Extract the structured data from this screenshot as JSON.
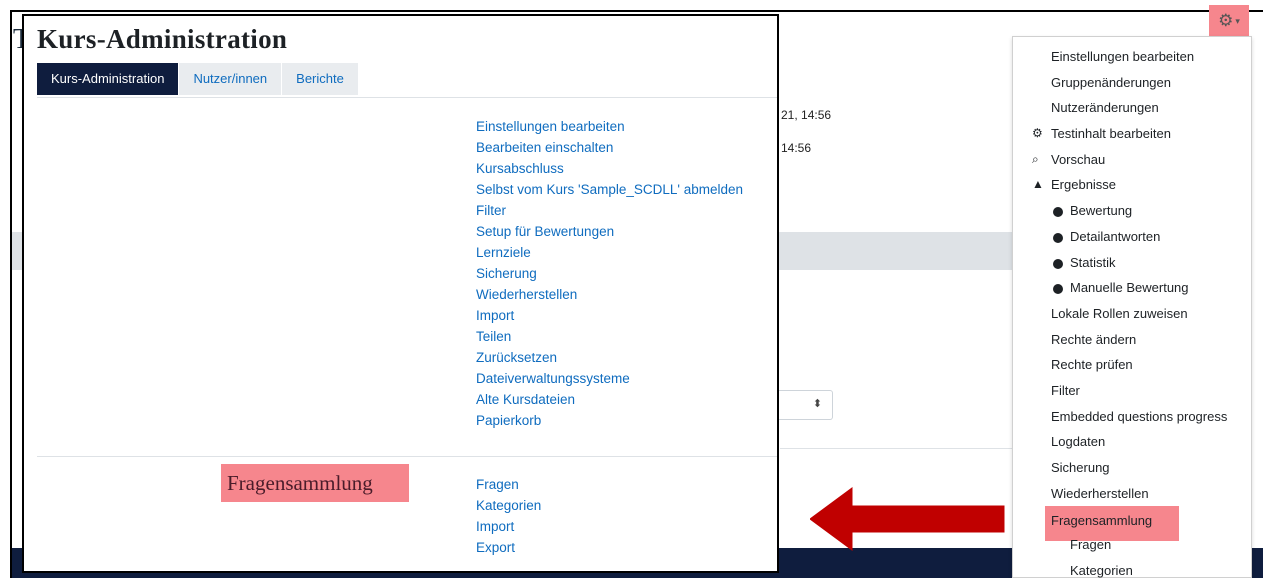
{
  "background": {
    "title_fragment": "T",
    "text_line_1": "21, 14:56",
    "text_line_2": "14:56",
    "select_caret": "⬍"
  },
  "admin": {
    "title": "Kurs-Administration",
    "tabs": [
      {
        "label": "Kurs-Administration",
        "active": true
      },
      {
        "label": "Nutzer/innen",
        "active": false
      },
      {
        "label": "Berichte",
        "active": false
      }
    ],
    "links": [
      "Einstellungen bearbeiten",
      "Bearbeiten einschalten",
      "Kursabschluss",
      "Selbst vom Kurs 'Sample_SCDLL' abmelden",
      "Filter",
      "Setup für Bewertungen",
      "Lernziele",
      "Sicherung",
      "Wiederherstellen",
      "Import",
      "Teilen",
      "Zurücksetzen",
      "Dateiverwaltungssysteme",
      "Alte Kursdateien",
      "Papierkorb"
    ],
    "question_bank": {
      "label": "Fragensammlung",
      "links": [
        "Fragen",
        "Kategorien",
        "Import",
        "Export"
      ]
    }
  },
  "action_menu": {
    "gear_icon": "⚙",
    "caret": "▾",
    "items": [
      {
        "label": "Einstellungen bearbeiten"
      },
      {
        "label": "Gruppenänderungen"
      },
      {
        "label": "Nutzeränderungen"
      },
      {
        "label": "Testinhalt bearbeiten",
        "icon": "⚙"
      },
      {
        "label": "Vorschau",
        "icon": "⌕"
      },
      {
        "label": "Ergebnisse",
        "icon": "▲"
      },
      {
        "label": "Bewertung"
      },
      {
        "label": "Detailantworten"
      },
      {
        "label": "Statistik"
      },
      {
        "label": "Manuelle Bewertung"
      },
      {
        "label": "Lokale Rollen zuweisen"
      },
      {
        "label": "Rechte ändern"
      },
      {
        "label": "Rechte prüfen"
      },
      {
        "label": "Filter"
      },
      {
        "label": "Embedded questions progress"
      },
      {
        "label": "Logdaten"
      },
      {
        "label": "Sicherung"
      },
      {
        "label": "Wiederherstellen"
      },
      {
        "label": "Fragensammlung"
      },
      {
        "label": "Fragen"
      },
      {
        "label": "Kategorien"
      }
    ]
  },
  "colors": {
    "highlight": "#f6868d",
    "arrow": "#c00000",
    "link": "#0f6cbf",
    "nav_dark": "#0f1d3e"
  }
}
